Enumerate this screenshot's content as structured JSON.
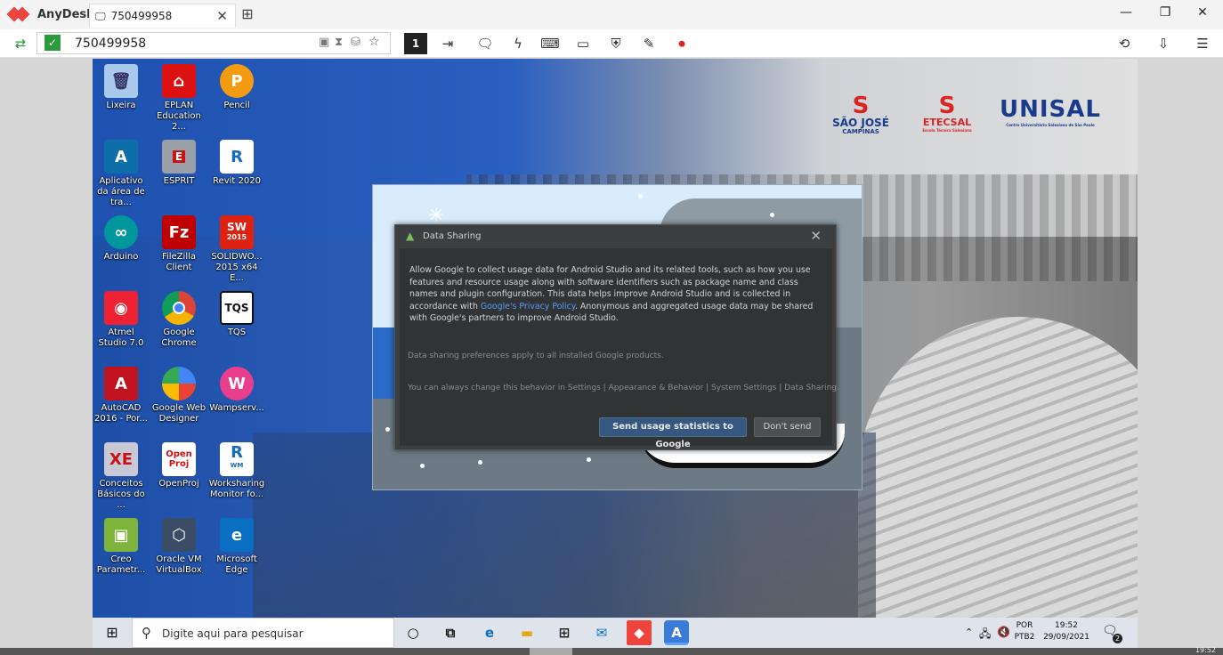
{
  "anydesk": {
    "app_name": "AnyDesk",
    "tab_title": "750499958",
    "address_value": "750499958",
    "display_badge": "1"
  },
  "desktop": {
    "logos": [
      "SÃO JOSÉ",
      "CAMPINAS",
      "ETECSAL",
      "Escola Técnica Salesiana",
      "UNISAL",
      "Centro Universitário Salesiano de São Paulo"
    ],
    "icons": [
      {
        "label": "Lixeira"
      },
      {
        "label": "EPLAN Education 2..."
      },
      {
        "label": "Pencil"
      },
      {
        "label": "Aplicativo da área de tra..."
      },
      {
        "label": "ESPRIT"
      },
      {
        "label": "Revit 2020"
      },
      {
        "label": "Arduino"
      },
      {
        "label": "FileZilla Client"
      },
      {
        "label": "SOLIDWO... 2015 x64 E..."
      },
      {
        "label": "Atmel Studio 7.0"
      },
      {
        "label": "Google Chrome"
      },
      {
        "label": "TQS"
      },
      {
        "label": "AutoCAD 2016 - Por..."
      },
      {
        "label": "Google Web Designer"
      },
      {
        "label": "Wampserv..."
      },
      {
        "label": "Conceitos Básicos do ..."
      },
      {
        "label": "OpenProj"
      },
      {
        "label": "Worksharing Monitor fo..."
      },
      {
        "label": "Creo Parametr..."
      },
      {
        "label": "Oracle VM VirtualBox"
      },
      {
        "label": "Microsoft Edge"
      }
    ],
    "icon_glyphs": [
      "TQS",
      "Fz",
      "SW",
      "2015",
      "R",
      "WM",
      "Open",
      "Proj",
      "XE",
      "E",
      "P"
    ]
  },
  "dialog": {
    "title": "Data Sharing",
    "body_pre": "Allow Google to collect usage data for Android Studio and its related tools, such as how you use features and resource usage along with software identifiers such as package name and class names and plugin configuration. This data helps improve Android Studio and is collected in accordance with ",
    "link": "Google's Privacy Policy",
    "body_post": ". Anonymous and aggregated usage data may be shared with Google's partners to improve Android Studio.",
    "note1": "Data sharing preferences apply to all installed Google products.",
    "note2": "You can always change this behavior in Settings | Appearance & Behavior | System Settings | Data Sharing.",
    "send_button": "Send usage statistics to Google",
    "dont_button": "Don't send"
  },
  "taskbar": {
    "search_placeholder": "Digite aqui para pesquisar",
    "lang_top": "POR",
    "lang_bottom": "PTB2",
    "time": "19:52",
    "date": "29/09/2021",
    "notification_count": "2"
  },
  "bottom_strip": {
    "time": "19:52"
  },
  "colors": {
    "anydesk_red": "#ef443b",
    "dialog_bg": "#3c3f41",
    "primary_button": "#365880",
    "link": "#589df6"
  }
}
